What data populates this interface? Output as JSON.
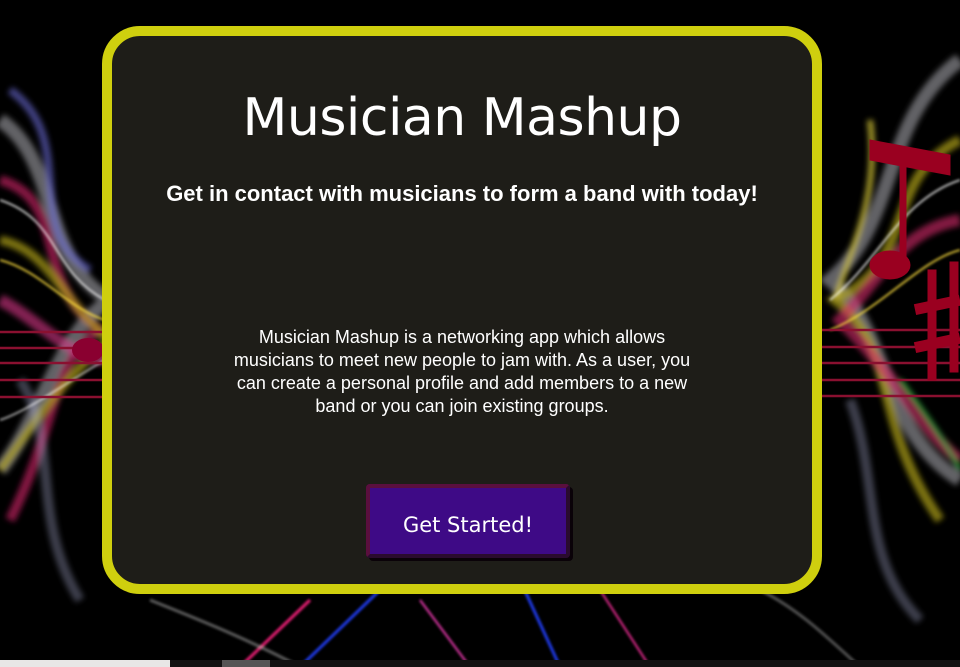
{
  "hero": {
    "title": "Musician Mashup",
    "tagline": "Get in contact with musicians to form a band with today!",
    "description": "Musician Mashup is a networking app which allows musicians to meet new people to jam with. As a user, you can create a personal profile and add members to a new band or you can join existing groups.",
    "cta_label": "Get Started!"
  },
  "colors": {
    "card_border": "#cfcf0e",
    "card_background": "#1e1d18",
    "button_background": "#3e0a86",
    "text": "#ffffff"
  }
}
